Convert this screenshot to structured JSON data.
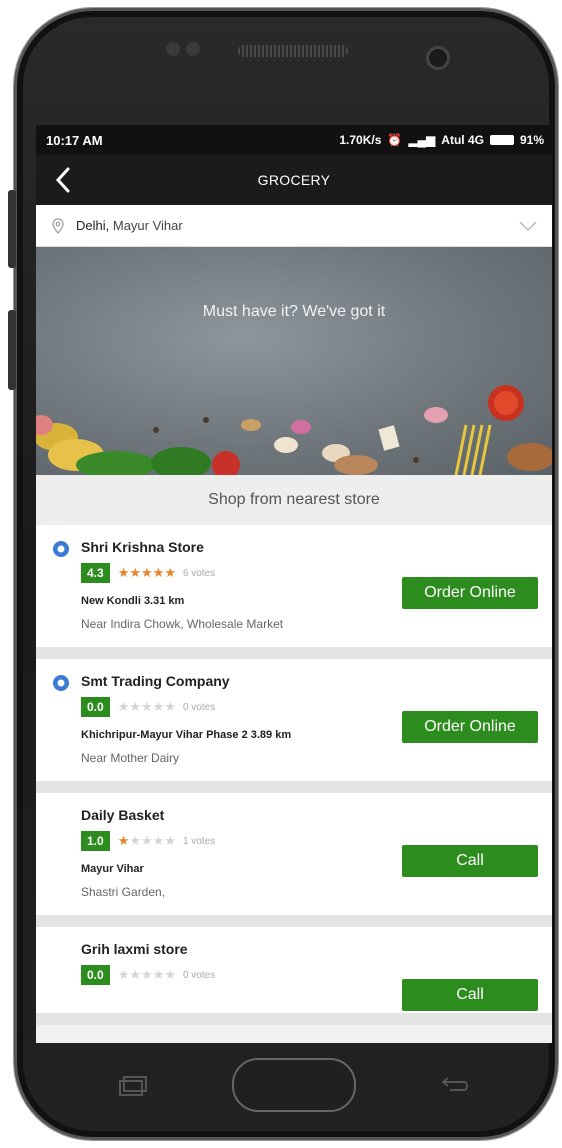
{
  "status_bar": {
    "time": "10:17 AM",
    "speed": "1.70K/s",
    "carrier": "Atul 4G",
    "battery": "91%"
  },
  "app_bar": {
    "title": "GROCERY",
    "back_icon": "chevron-left-icon"
  },
  "location": {
    "city": "Delhi,",
    "area": " Mayur Vihar"
  },
  "banner": {
    "headline": "Must have it? We've got it"
  },
  "section": {
    "nearest_label": "Shop from nearest store"
  },
  "stores": [
    {
      "name": "Shri Krishna Store",
      "rating": "4.3",
      "stars_filled": 4.5,
      "votes": "6 votes",
      "address_line1": "New Kondli 3.31 km",
      "address_line2": "Near Indira Chowk, Wholesale Market",
      "action_label": "Order Online",
      "verified": true
    },
    {
      "name": "Smt Trading Company",
      "rating": "0.0",
      "stars_filled": 0,
      "votes": "0 votes",
      "address_line1": "Khichripur-Mayur Vihar Phase 2 3.89 km",
      "address_line2": "Near Mother Dairy",
      "action_label": "Order Online",
      "verified": true
    },
    {
      "name": "Daily Basket",
      "rating": "1.0",
      "stars_filled": 1,
      "votes": "1 votes",
      "address_line1": "Mayur Vihar",
      "address_line2": "Shastri Garden,",
      "action_label": "Call",
      "verified": false
    },
    {
      "name": "Grih laxmi store",
      "rating": "0.0",
      "stars_filled": 0,
      "votes": "0 votes",
      "address_line1": "",
      "address_line2": "",
      "action_label": "Call",
      "verified": false
    }
  ],
  "colors": {
    "accent_green": "#2c8c1e",
    "star_orange": "#e8842a",
    "verified_blue": "#3b7bd4",
    "appbar_dark": "#1b1b1b"
  }
}
